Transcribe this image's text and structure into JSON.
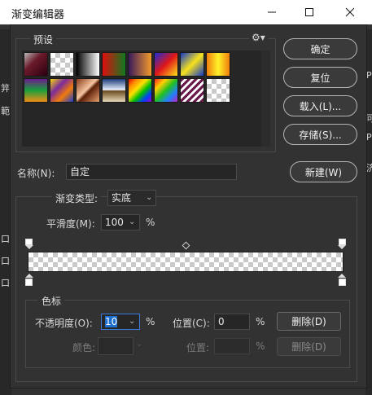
{
  "window": {
    "title": "渐变编辑器",
    "minimize_icon": "minimize-icon",
    "maximize_icon": "maximize-icon",
    "close_icon": "close-icon"
  },
  "background_labels": {
    "left": [
      "笄",
      "範",
      "口",
      "口",
      "口"
    ],
    "right": [
      "P",
      "可",
      "P",
      "济"
    ]
  },
  "presets": {
    "label": "预设",
    "menu_icon": "gear-icon",
    "swatches": [
      {
        "name": "foreground-to-background",
        "css": "linear-gradient(135deg,#b8b8b8,#6b1a2a 40%,#2b0010)"
      },
      {
        "name": "foreground-to-transparent",
        "css": "checker"
      },
      {
        "name": "black-white",
        "css": "linear-gradient(90deg,#000,#fff)"
      },
      {
        "name": "red-green",
        "css": "linear-gradient(90deg,#e10e0e,#0f7a1f)"
      },
      {
        "name": "violet-orange",
        "css": "linear-gradient(90deg,#3a1a5c,#f39a2a)"
      },
      {
        "name": "blue-red-yellow",
        "css": "linear-gradient(135deg,#1d2ad6,#e01818 50%,#ffe21a)"
      },
      {
        "name": "blue-yellow-blue",
        "css": "linear-gradient(135deg,#1238c8,#f7e21c 50%,#1238c8)"
      },
      {
        "name": "orange-yellow-orange",
        "css": "linear-gradient(90deg,#f07d0c,#fff22a 50%,#f07d0c)"
      },
      {
        "name": "violet-green-orange",
        "css": "linear-gradient(180deg,#6c1c8c,#1aa03c 50%,#f08c14)"
      },
      {
        "name": "yellow-violet-orange-blue",
        "css": "linear-gradient(135deg,#f5d80c,#7a2a9c 35%,#f07a0c 65%,#1e3cc8)"
      },
      {
        "name": "copper",
        "css": "linear-gradient(135deg,#8a3c18,#f6c6a2 45%,#5c2008 55%,#e6a070)"
      },
      {
        "name": "chrome",
        "css": "linear-gradient(180deg,#1a3c78,#eaf2ff 48%,#6a4a1c 52%,#e8d8b8)"
      },
      {
        "name": "spectrum",
        "css": "linear-gradient(135deg,#e00000,#ff8c00,#ffe000,#00c000,#0040ff,#a000c0)"
      },
      {
        "name": "transparent-rainbow",
        "css": "linear-gradient(135deg,#ff2020,#ffd000,#20c020,#2080ff,#c020c0)"
      },
      {
        "name": "transparent-stripes",
        "css": "repeating-linear-gradient(135deg,#6a1a4a 0 3px,#ffffff 3px 6px)"
      },
      {
        "name": "transparent",
        "css": "checker"
      }
    ]
  },
  "buttons": {
    "ok": "确定",
    "reset": "复位",
    "load": "载入(L)...",
    "save": "存储(S)...",
    "new": "新建(W)"
  },
  "name": {
    "label": "名称(N):",
    "value": "自定"
  },
  "gradient_type": {
    "label": "渐变类型:",
    "value": "实底"
  },
  "smoothness": {
    "label": "平滑度(M):",
    "value": "100",
    "unit": "%"
  },
  "stops_panel": {
    "label": "色标",
    "opacity_label": "不透明度(O):",
    "opacity_value": "10",
    "opacity_unit": "%",
    "opacity_location_label": "位置(C):",
    "opacity_location_value": "0",
    "opacity_location_unit": "%",
    "delete_label": "删除(D)",
    "color_label": "颜色:",
    "color_location_label": "位置:",
    "color_location_unit": "%",
    "color_delete_label": "删除(D)"
  },
  "colors": {
    "dialog_bg": "#323232",
    "field_bg": "#262626",
    "selection": "#1f6fd0"
  }
}
